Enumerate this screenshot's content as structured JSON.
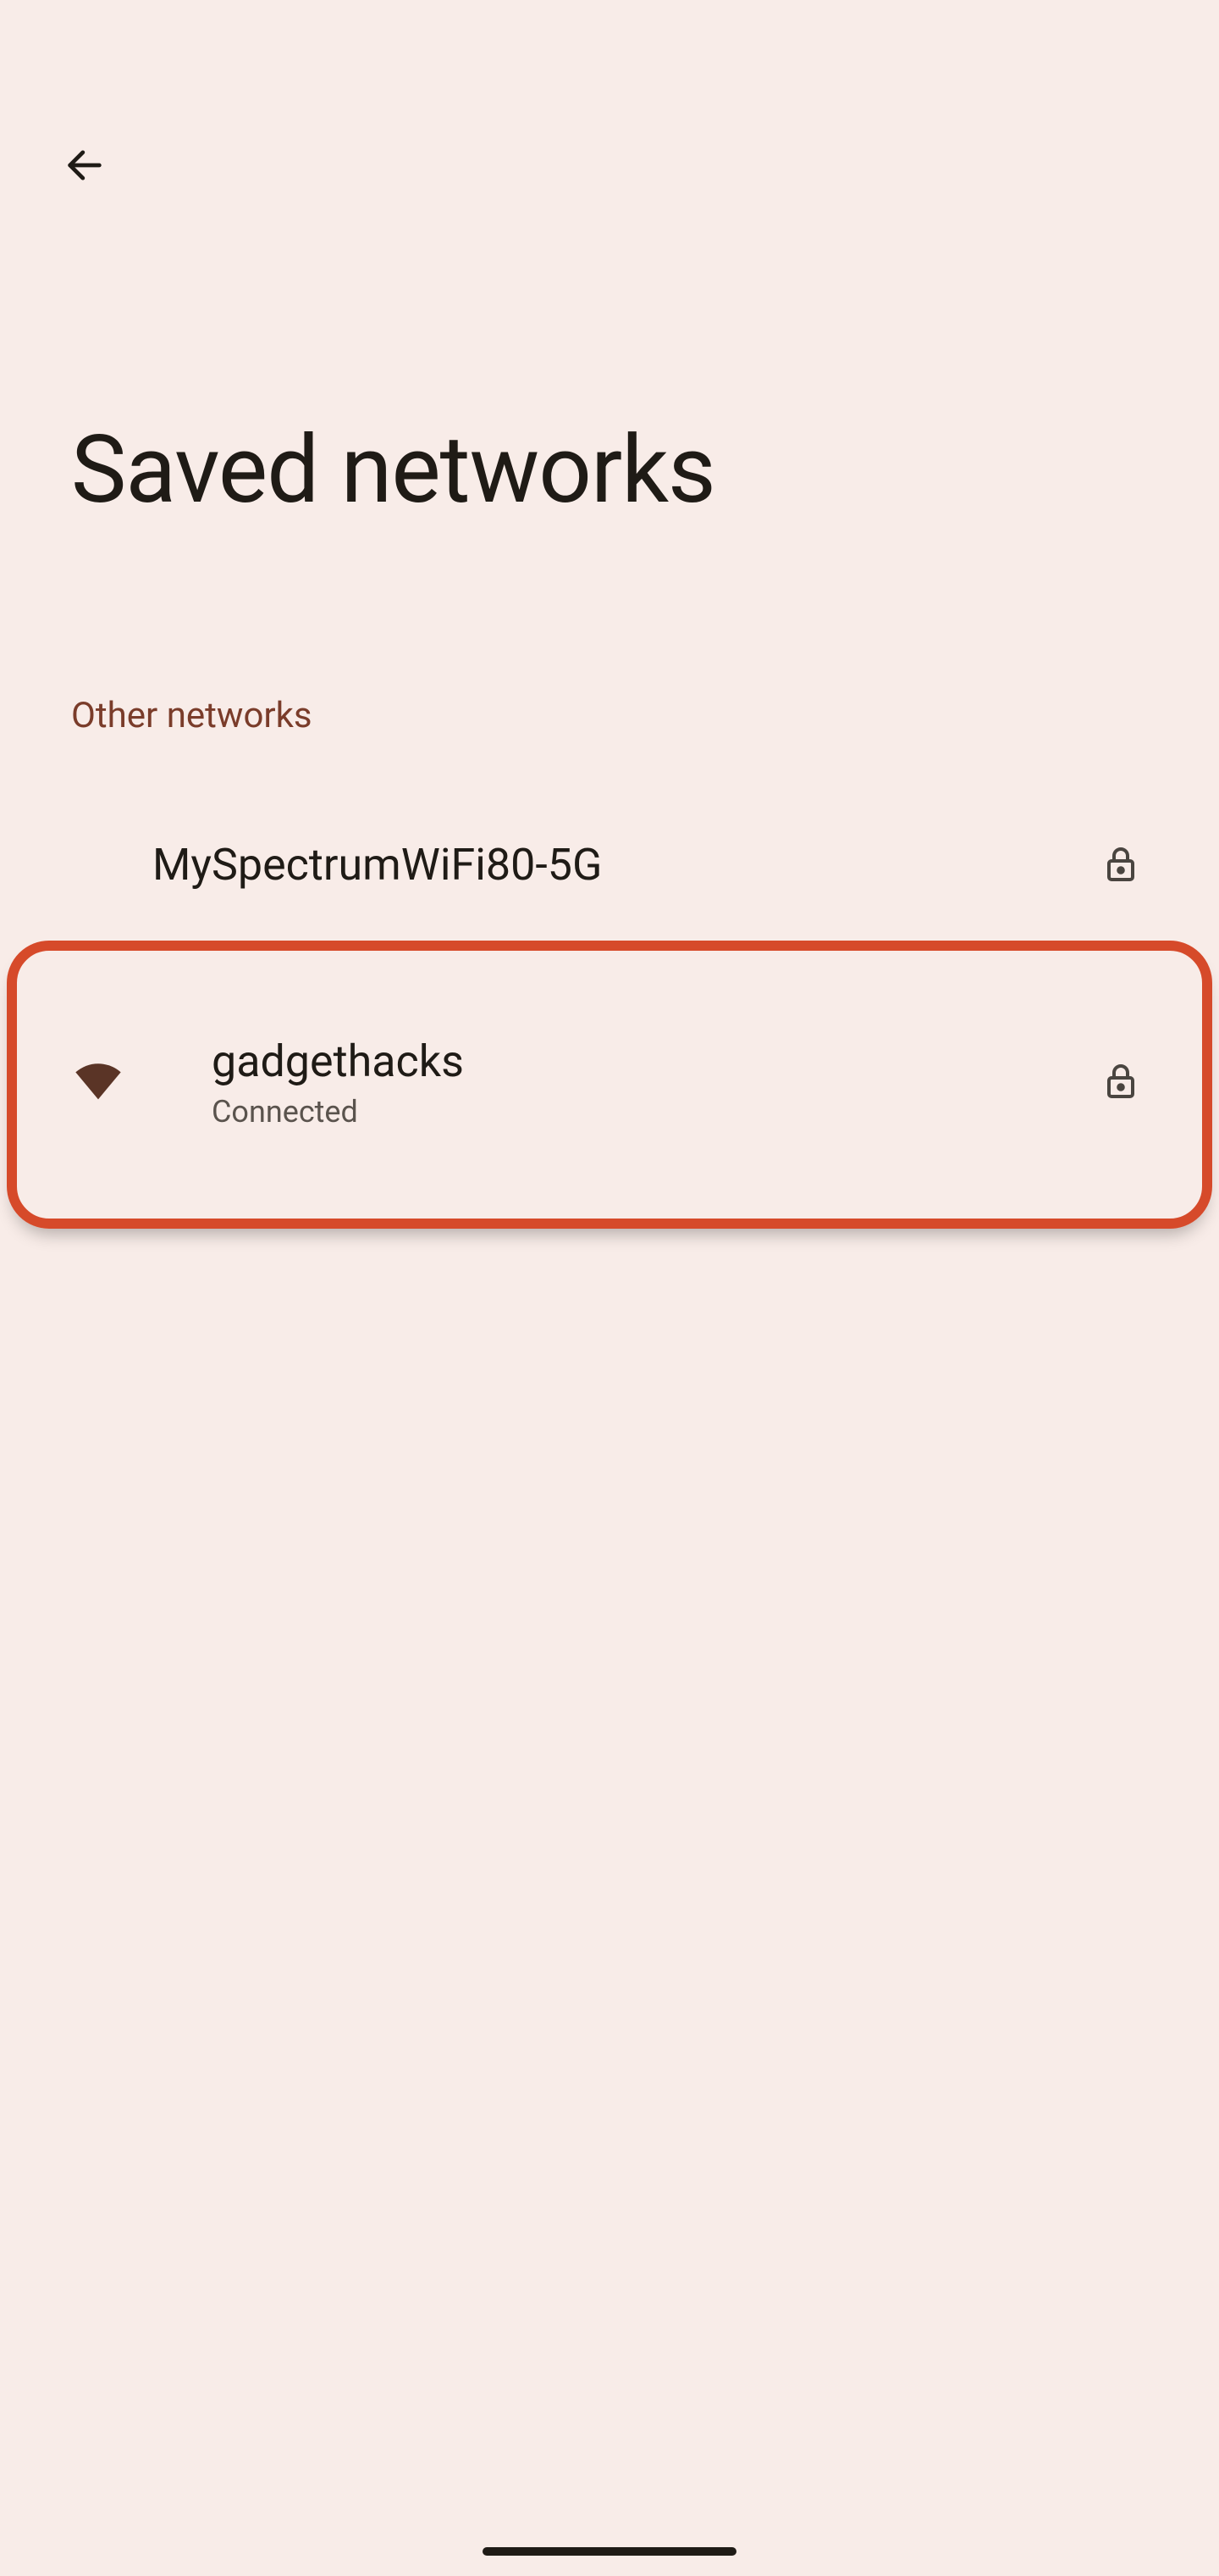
{
  "header": {
    "title": "Saved networks"
  },
  "sections": {
    "other_networks_label": "Other networks"
  },
  "networks": [
    {
      "ssid": "MySpectrumWiFi80-5G",
      "status": "",
      "secured": true,
      "has_signal_icon": false,
      "connected": false
    },
    {
      "ssid": "gadgethacks",
      "status": "Connected",
      "secured": true,
      "has_signal_icon": true,
      "connected": true
    }
  ],
  "colors": {
    "background": "#f8ece8",
    "accent": "#7a3c2a",
    "highlight_border": "#d64a2a",
    "text_primary": "#1f1b16",
    "text_secondary": "#5a534d"
  }
}
